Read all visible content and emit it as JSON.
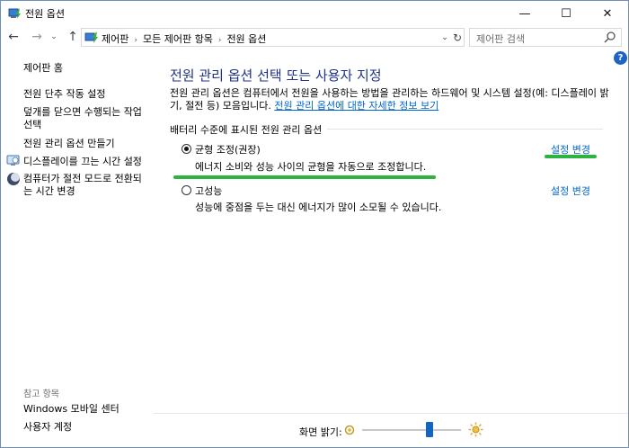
{
  "window": {
    "title": "전원 옵션",
    "controls": {
      "minimize": "—",
      "maximize": "☐",
      "close": "✕"
    }
  },
  "nav": {
    "breadcrumbs": [
      "제어판",
      "모든 제어판 항목",
      "전원 옵션"
    ],
    "search_placeholder": "제어판 검색"
  },
  "sidebar": {
    "items": [
      {
        "label": "제어판 홈"
      },
      {
        "label": "전원 단추 작동 설정"
      },
      {
        "label": "덮개를 닫으면 수행되는 작업 선택"
      },
      {
        "label": "전원 관리 옵션 만들기"
      },
      {
        "label": "디스플레이를 끄는 시간 설정",
        "icon": "monitor-icon"
      },
      {
        "label": "컴퓨터가 절전 모드로 전환되는 시간 변경",
        "icon": "moon-icon"
      }
    ],
    "see_also_title": "참고 항목",
    "see_also": [
      {
        "label": "Windows 모바일 센터"
      },
      {
        "label": "사용자 계정"
      }
    ]
  },
  "main": {
    "title": "전원 관리 옵션 선택 또는 사용자 지정",
    "desc_text": "전원 관리 옵션은 컴퓨터에서 전원을 사용하는 방법을 관리하는 하드웨어 및 시스템 설정(예: 디스플레이 밝기, 절전 등) 모음입니다. ",
    "desc_link": "전원 관리 옵션에 대한 자세한 정보 보기",
    "group_label": "배터리 수준에 표시된 전원 관리 옵션",
    "plans": [
      {
        "name": "균형 조정(권장)",
        "desc": "에너지 소비와 성능 사이의 균형을 자동으로 조정합니다.",
        "link": "설정 변경",
        "selected": true
      },
      {
        "name": "고성능",
        "desc": "성능에 중점을 두는 대신 에너지가 많이 소모될 수 있습니다.",
        "link": "설정 변경",
        "selected": false
      }
    ]
  },
  "bottom": {
    "brightness_label": "화면 밝기:",
    "brightness_level": 0.68
  },
  "colors": {
    "title_blue": "#1e3287",
    "link_blue": "#0066cc",
    "annotation_green": "#2eb43e",
    "slider_blue": "#1565c0"
  }
}
